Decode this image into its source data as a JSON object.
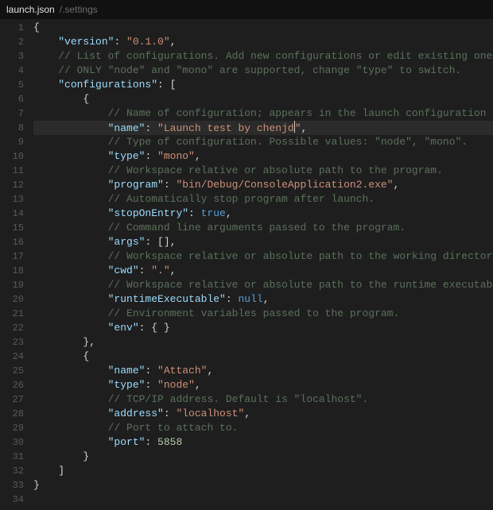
{
  "tab": {
    "filename": "launch.json",
    "folder": "/.settings"
  },
  "code": {
    "total_lines": 34,
    "highlight_line": 8,
    "lines": [
      {
        "n": 1,
        "indent": 0,
        "tokens": [
          {
            "t": "brace",
            "v": "{"
          }
        ]
      },
      {
        "n": 2,
        "indent": 1,
        "tokens": [
          {
            "t": "key",
            "v": "\"version\""
          },
          {
            "t": "colon",
            "v": ": "
          },
          {
            "t": "string",
            "v": "\"0.1.0\""
          },
          {
            "t": "punct",
            "v": ","
          }
        ]
      },
      {
        "n": 3,
        "indent": 1,
        "tokens": [
          {
            "t": "comment",
            "v": "// List of configurations. Add new configurations or edit existing ones."
          }
        ]
      },
      {
        "n": 4,
        "indent": 1,
        "tokens": [
          {
            "t": "comment",
            "v": "// ONLY \"node\" and \"mono\" are supported, change \"type\" to switch."
          }
        ]
      },
      {
        "n": 5,
        "indent": 1,
        "tokens": [
          {
            "t": "key",
            "v": "\"configurations\""
          },
          {
            "t": "colon",
            "v": ": "
          },
          {
            "t": "punct",
            "v": "["
          }
        ]
      },
      {
        "n": 6,
        "indent": 2,
        "tokens": [
          {
            "t": "brace",
            "v": "{"
          }
        ]
      },
      {
        "n": 7,
        "indent": 3,
        "tokens": [
          {
            "t": "comment",
            "v": "// Name of configuration; appears in the launch configuration drop d"
          }
        ]
      },
      {
        "n": 8,
        "indent": 3,
        "tokens": [
          {
            "t": "key",
            "v": "\"name\""
          },
          {
            "t": "colon",
            "v": ": "
          },
          {
            "t": "string",
            "v": "\"Launch test by chenjd"
          },
          {
            "t": "cursor",
            "v": ""
          },
          {
            "t": "string",
            "v": "\""
          },
          {
            "t": "punct",
            "v": ","
          }
        ]
      },
      {
        "n": 9,
        "indent": 3,
        "tokens": [
          {
            "t": "comment",
            "v": "// Type of configuration. Possible values: \"node\", \"mono\"."
          }
        ]
      },
      {
        "n": 10,
        "indent": 3,
        "tokens": [
          {
            "t": "key",
            "v": "\"type\""
          },
          {
            "t": "colon",
            "v": ": "
          },
          {
            "t": "string",
            "v": "\"mono\""
          },
          {
            "t": "punct",
            "v": ","
          }
        ]
      },
      {
        "n": 11,
        "indent": 3,
        "tokens": [
          {
            "t": "comment",
            "v": "// Workspace relative or absolute path to the program."
          }
        ]
      },
      {
        "n": 12,
        "indent": 3,
        "tokens": [
          {
            "t": "key",
            "v": "\"program\""
          },
          {
            "t": "colon",
            "v": ": "
          },
          {
            "t": "string",
            "v": "\"bin/Debug/ConsoleApplication2.exe\""
          },
          {
            "t": "punct",
            "v": ","
          }
        ]
      },
      {
        "n": 13,
        "indent": 3,
        "tokens": [
          {
            "t": "comment",
            "v": "// Automatically stop program after launch."
          }
        ]
      },
      {
        "n": 14,
        "indent": 3,
        "tokens": [
          {
            "t": "key",
            "v": "\"stopOnEntry\""
          },
          {
            "t": "colon",
            "v": ": "
          },
          {
            "t": "bool",
            "v": "true"
          },
          {
            "t": "punct",
            "v": ","
          }
        ]
      },
      {
        "n": 15,
        "indent": 3,
        "tokens": [
          {
            "t": "comment",
            "v": "// Command line arguments passed to the program."
          }
        ]
      },
      {
        "n": 16,
        "indent": 3,
        "tokens": [
          {
            "t": "key",
            "v": "\"args\""
          },
          {
            "t": "colon",
            "v": ": "
          },
          {
            "t": "punct",
            "v": "[],"
          }
        ]
      },
      {
        "n": 17,
        "indent": 3,
        "tokens": [
          {
            "t": "comment",
            "v": "// Workspace relative or absolute path to the working directory of t"
          }
        ]
      },
      {
        "n": 18,
        "indent": 3,
        "tokens": [
          {
            "t": "key",
            "v": "\"cwd\""
          },
          {
            "t": "colon",
            "v": ": "
          },
          {
            "t": "string",
            "v": "\".\""
          },
          {
            "t": "punct",
            "v": ","
          }
        ]
      },
      {
        "n": 19,
        "indent": 3,
        "tokens": [
          {
            "t": "comment",
            "v": "// Workspace relative or absolute path to the runtime executable to "
          }
        ]
      },
      {
        "n": 20,
        "indent": 3,
        "tokens": [
          {
            "t": "key",
            "v": "\"runtimeExecutable\""
          },
          {
            "t": "colon",
            "v": ": "
          },
          {
            "t": "null",
            "v": "null"
          },
          {
            "t": "punct",
            "v": ","
          }
        ]
      },
      {
        "n": 21,
        "indent": 3,
        "tokens": [
          {
            "t": "comment",
            "v": "// Environment variables passed to the program."
          }
        ]
      },
      {
        "n": 22,
        "indent": 3,
        "tokens": [
          {
            "t": "key",
            "v": "\"env\""
          },
          {
            "t": "colon",
            "v": ": "
          },
          {
            "t": "brace",
            "v": "{ }"
          }
        ]
      },
      {
        "n": 23,
        "indent": 2,
        "tokens": [
          {
            "t": "brace",
            "v": "}"
          },
          {
            "t": "punct",
            "v": ","
          }
        ]
      },
      {
        "n": 24,
        "indent": 2,
        "tokens": [
          {
            "t": "brace",
            "v": "{"
          }
        ]
      },
      {
        "n": 25,
        "indent": 3,
        "tokens": [
          {
            "t": "key",
            "v": "\"name\""
          },
          {
            "t": "colon",
            "v": ": "
          },
          {
            "t": "string",
            "v": "\"Attach\""
          },
          {
            "t": "punct",
            "v": ","
          }
        ]
      },
      {
        "n": 26,
        "indent": 3,
        "tokens": [
          {
            "t": "key",
            "v": "\"type\""
          },
          {
            "t": "colon",
            "v": ": "
          },
          {
            "t": "string",
            "v": "\"node\""
          },
          {
            "t": "punct",
            "v": ","
          }
        ]
      },
      {
        "n": 27,
        "indent": 3,
        "tokens": [
          {
            "t": "comment",
            "v": "// TCP/IP address. Default is \"localhost\"."
          }
        ]
      },
      {
        "n": 28,
        "indent": 3,
        "tokens": [
          {
            "t": "key",
            "v": "\"address\""
          },
          {
            "t": "colon",
            "v": ": "
          },
          {
            "t": "string",
            "v": "\"localhost\""
          },
          {
            "t": "punct",
            "v": ","
          }
        ]
      },
      {
        "n": 29,
        "indent": 3,
        "tokens": [
          {
            "t": "comment",
            "v": "// Port to attach to."
          }
        ]
      },
      {
        "n": 30,
        "indent": 3,
        "tokens": [
          {
            "t": "key",
            "v": "\"port\""
          },
          {
            "t": "colon",
            "v": ": "
          },
          {
            "t": "number",
            "v": "5858"
          }
        ]
      },
      {
        "n": 31,
        "indent": 2,
        "tokens": [
          {
            "t": "brace",
            "v": "}"
          }
        ]
      },
      {
        "n": 32,
        "indent": 1,
        "tokens": [
          {
            "t": "punct",
            "v": "]"
          }
        ]
      },
      {
        "n": 33,
        "indent": 0,
        "tokens": [
          {
            "t": "brace",
            "v": "}"
          }
        ]
      },
      {
        "n": 34,
        "indent": 0,
        "tokens": []
      }
    ]
  }
}
